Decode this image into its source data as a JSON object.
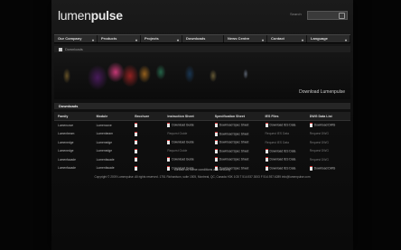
{
  "brand": {
    "logo_light": "lumen",
    "logo_bold": "pulse"
  },
  "search": {
    "label": "Search",
    "value": ""
  },
  "nav": [
    {
      "label": "Our Company",
      "dropdown": true,
      "w": 48
    },
    {
      "label": "Products",
      "dropdown": true,
      "w": 48
    },
    {
      "label": "Projects",
      "dropdown": true,
      "w": 46
    },
    {
      "label": "Downloads",
      "dropdown": false,
      "w": 46
    },
    {
      "label": "News Centre",
      "dropdown": true,
      "w": 48
    },
    {
      "label": "Contact",
      "dropdown": true,
      "w": 44
    },
    {
      "label": "Language",
      "dropdown": true,
      "w": 48
    }
  ],
  "breadcrumb": {
    "current": "Downloads"
  },
  "banner": {
    "caption": "Download Lumenpulse"
  },
  "section": {
    "title": "Downloads"
  },
  "table": {
    "headers": [
      "Family",
      "Module",
      "Brochure",
      "Instruction Sheet",
      "Specification Sheet",
      "IES Files",
      "DWG Data List"
    ],
    "rows": [
      [
        "Lumencove",
        "Lumencove",
        "pdf",
        "Download Guide",
        "Download Spec Sheet",
        "Download IES Data",
        "Download DWG"
      ],
      [
        "Lumenbeam",
        "Lumenbeam",
        "pdf",
        "Request Guide",
        "Download Spec Sheet",
        "Request IES Data",
        "Request DWG"
      ],
      [
        "Lumenedge",
        "Lumenedge",
        "pdf",
        "Download Guide",
        "Download Spec Sheet",
        "Request IES Data",
        "Request DWG"
      ],
      [
        "Lumenedge",
        "Lumenedge",
        "pdf",
        "Request Guide",
        "Download Spec Sheet",
        "Download IES Data",
        "Request DWG"
      ],
      [
        "Lumenfacade",
        "Lumenfacade",
        "pdf",
        "Download Guide",
        "Download Spec Sheet",
        "Download IES Data",
        "Request DWG"
      ],
      [
        "Lumenfacade",
        "Lumenfacade",
        "pdf",
        "Download Guide",
        "Download Spec Sheet",
        "Download IES Data",
        "Download DWG"
      ]
    ]
  },
  "footer": {
    "links": "contact us   home   conditions and security",
    "copyright": "Copyright © 2009 Lumenpulse. All rights reserved.  1751 Richardson, suite 1505, Montreal, QC, Canada H3K 1G5  T 514.937.3003  F 514.937.6289  info@lumenpulse.com"
  },
  "colors": {
    "background": "#050505",
    "page": "#141414",
    "nav": "#2b2b2b",
    "accent_pdf": "#cc3333"
  }
}
